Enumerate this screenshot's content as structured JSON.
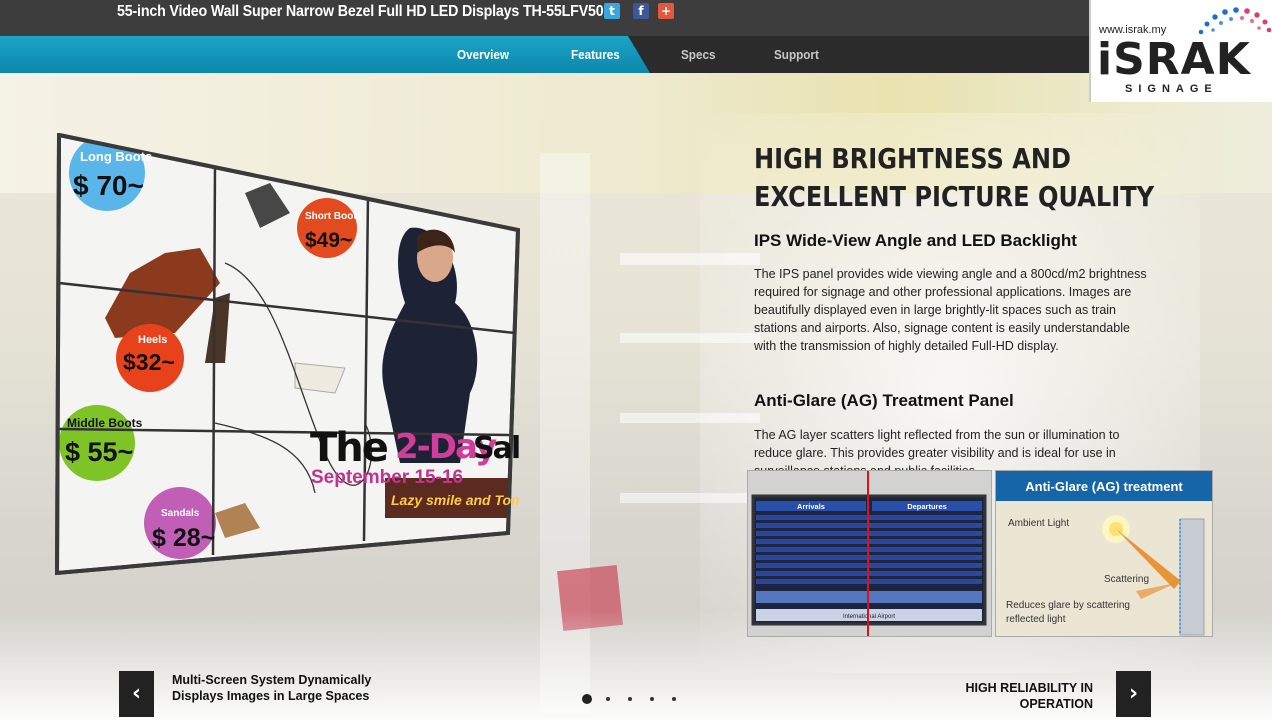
{
  "header": {
    "title": "55-inch Video Wall Super Narrow Bezel Full HD LED Displays TH-55LFV50",
    "social": [
      {
        "name": "twitter-icon",
        "glyph": "t"
      },
      {
        "name": "facebook-icon",
        "glyph": "f"
      },
      {
        "name": "google-plus-icon",
        "glyph": "+"
      }
    ]
  },
  "nav": {
    "tabs": [
      "Overview",
      "Features",
      "Specs",
      "Support"
    ]
  },
  "logo": {
    "url": "www.israk.my",
    "brand": "iSRAK",
    "sub": "SIGNAGE"
  },
  "wall": {
    "long_boots": "Long Boots",
    "long_boots_price": "$ 70~",
    "short_boots": "Short Boots",
    "short_boots_price": "$49~",
    "heels": "Heels",
    "heels_price": "$32~",
    "middle_boots": "Middle Boots",
    "middle_boots_price": "$ 55~",
    "sandals": "Sandals",
    "sandals_price": "$ 28~",
    "sale_the": "The",
    "sale_days": "2-Day",
    "sale_word": "Sale",
    "sale_dates": "September 15-16",
    "sale_tag": "Lazy smile and Tom"
  },
  "main": {
    "heading_line1": "HIGH BRIGHTNESS AND",
    "heading_line2": "EXCELLENT PICTURE QUALITY",
    "sub1": "IPS Wide-View Angle and LED Backlight",
    "para1": "The IPS panel provides wide viewing angle and a 800cd/m2 brightness required for signage and other professional applications. Images are beautifully displayed even in large brightly-lit spaces such as train stations and airports. Also, signage content is easily understandable with the transmission of highly detailed Full-HD display.",
    "sub2": "Anti-Glare (AG) Treatment Panel",
    "para2": "The AG layer scatters light reflected from the sun or illumination to reduce glare. This provides greater visibility and is ideal for use in surveillance stations and public facilities."
  },
  "boards": {
    "arrivals": "Arrivals",
    "departures": "Departures",
    "footer": "International Airport"
  },
  "ag": {
    "title": "Anti-Glare (AG) treatment",
    "ambient": "Ambient Light",
    "scattering": "Scattering",
    "reduces": "Reduces glare by scattering reflected light"
  },
  "footer": {
    "prev_label": "Multi-Screen System Dynamically Displays Images in Large Spaces",
    "next_label": "HIGH RELIABILITY IN OPERATION",
    "prev_glyph": "‹",
    "next_glyph": "›"
  },
  "colors": {
    "nav_blue": "#1aa5c7",
    "ag_header": "#1565a8"
  }
}
